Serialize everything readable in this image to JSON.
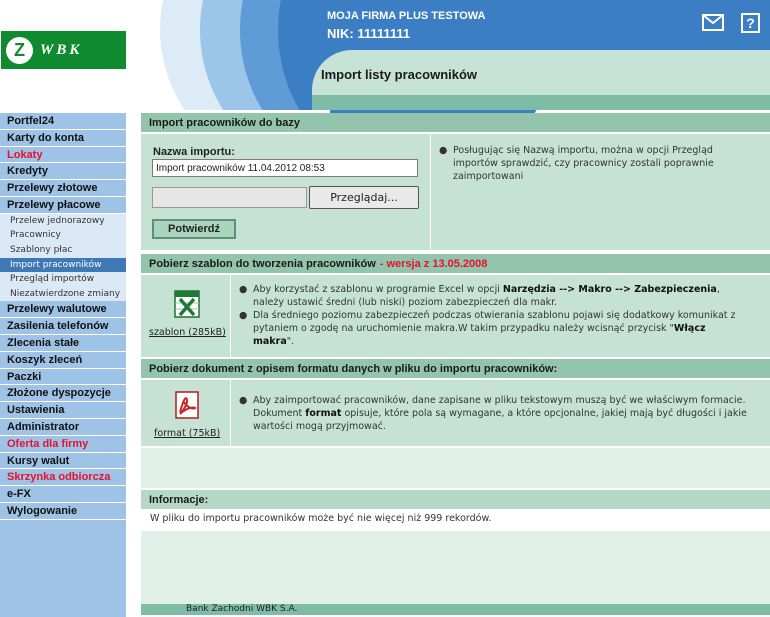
{
  "header": {
    "logo_text": "WBK",
    "company_name": "MOJA FIRMA PLUS TESTOWA",
    "nik": "NIK: 11111111",
    "page_title": "Import listy pracowników",
    "mail_icon": "mail-icon",
    "help_icon": "help-icon",
    "help_glyph": "?"
  },
  "sidebar": {
    "items": [
      {
        "label": "Portfel24",
        "type": "main"
      },
      {
        "label": "Karty do konta",
        "type": "main"
      },
      {
        "label": "Lokaty",
        "type": "main",
        "highlight": true
      },
      {
        "label": "Kredyty",
        "type": "main"
      },
      {
        "label": "Przelewy złotowe",
        "type": "main"
      },
      {
        "label": "Przelewy płacowe",
        "type": "main"
      },
      {
        "label": "Przelew jednorazowy",
        "type": "sub"
      },
      {
        "label": "Pracownicy",
        "type": "sub"
      },
      {
        "label": "Szablony płac",
        "type": "sub"
      },
      {
        "label": "Import pracowników",
        "type": "sub",
        "active": true
      },
      {
        "label": "Przegląd importów",
        "type": "sub"
      },
      {
        "label": "Niezatwierdzone zmiany",
        "type": "sub"
      },
      {
        "label": "Przelewy walutowe",
        "type": "main"
      },
      {
        "label": "Zasilenia telefonów",
        "type": "main"
      },
      {
        "label": "Zlecenia stałe",
        "type": "main"
      },
      {
        "label": "Koszyk zleceń",
        "type": "main"
      },
      {
        "label": "Paczki",
        "type": "main"
      },
      {
        "label": "Złożone dyspozycje",
        "type": "main"
      },
      {
        "label": "Ustawienia",
        "type": "main"
      },
      {
        "label": "Administrator",
        "type": "main"
      },
      {
        "label": "Oferta dla firmy",
        "type": "main",
        "highlight": true
      },
      {
        "label": "Kursy walut",
        "type": "main"
      },
      {
        "label": "Skrzynka odbiorcza",
        "type": "main",
        "highlight": true
      },
      {
        "label": "e-FX",
        "type": "main"
      },
      {
        "label": "Wylogowanie",
        "type": "main"
      }
    ]
  },
  "import_section": {
    "title": "Import pracowników do bazy",
    "name_label": "Nazwa importu:",
    "name_value": "Import pracowników 11.04.2012 08:53",
    "file_value": "",
    "browse_label": "Przeglądaj...",
    "confirm_label": "Potwierdź",
    "hint": "Posługując się Nazwą importu, można w opcji Przegląd importów sprawdzić, czy pracownicy zostali poprawnie zaimportowani"
  },
  "template_section": {
    "title": "Pobierz szablon do tworzenia pracowników",
    "version": "- wersja z 13.05.2008",
    "file_label": "szablon (285kB)",
    "file_icon": "excel-icon",
    "bullet1_pre": "Aby korzystać z szablonu w programie Excel w opcji ",
    "bullet1_bold1": "Narzędzia --> Makro --> Zabezpieczenia",
    "bullet1_post": ", należy ustawić średni (lub niski) poziom zabezpieczeń dla makr.",
    "bullet2_pre": "Dla średniego poziomu zabezpieczeń podczas otwierania szablonu pojawi się dodatkowy komunikat z pytaniem o zgodę na uruchomienie makra.W takim przypadku należy wcisnąć przycisk \"",
    "bullet2_bold": "Włącz makra",
    "bullet2_post": "\"."
  },
  "format_section": {
    "title": "Pobierz dokument z opisem formatu danych w pliku do importu pracowników:",
    "file_label": "format (75kB)",
    "file_icon": "pdf-icon",
    "bullet_pre1": "Aby zaimportować pracowników, dane zapisane w pliku tekstowym muszą być we właściwym formacie. Dokument ",
    "bullet_bold": "format",
    "bullet_post": " opisuje, które pola są wymagane, a które opcjonalne, jakiej mają być długości i jakie wartości mogą przyjmować."
  },
  "info_section": {
    "title": "Informacje:",
    "text": "W pliku do importu pracowników może być nie więcej niż 999 rekordów."
  },
  "footer": {
    "text": "Bank Zachodni WBK S.A."
  },
  "colors": {
    "header_blue": "#3c7ec3",
    "header_green": "#c7e3d8",
    "section_header": "#93c4ae",
    "section_body": "#c6e2d4",
    "sidebar": "#9fc3e7",
    "sidebar_active": "#3f78b6",
    "logo_green": "#0f8a2e",
    "highlight_red": "#e8102a"
  }
}
